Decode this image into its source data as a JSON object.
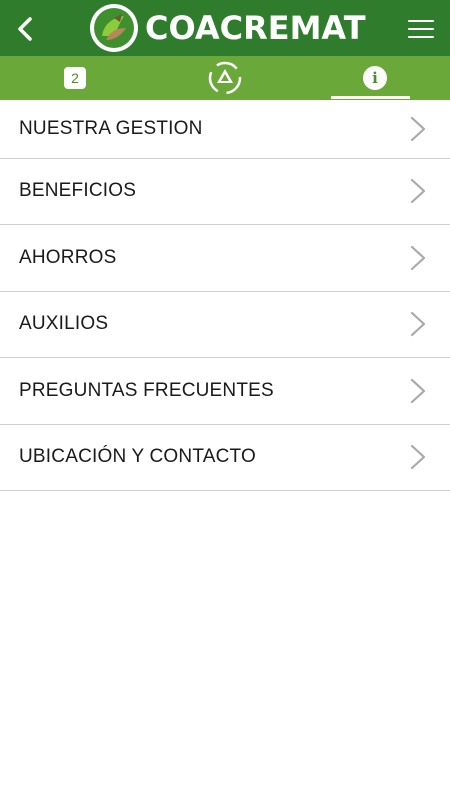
{
  "header": {
    "brand": "COACREMAT",
    "back_icon": "chevron-left-icon",
    "menu_icon": "hamburger-menu-icon",
    "logo_icon": "coacremat-logo",
    "color": "#2f7d2c"
  },
  "tabs": [
    {
      "badge": "2",
      "icon": "notification-badge-icon",
      "active": false
    },
    {
      "icon": "recycle-triangle-icon",
      "active": false
    },
    {
      "icon": "info-icon",
      "symbol": "i",
      "active": true
    }
  ],
  "tab_bar_color": "#6aa83a",
  "menu": {
    "items": [
      {
        "label": "NUESTRA GESTION"
      },
      {
        "label": "BENEFICIOS"
      },
      {
        "label": "AHORROS"
      },
      {
        "label": "AUXILIOS"
      },
      {
        "label": "PREGUNTAS FRECUENTES"
      },
      {
        "label": "UBICACIÓN Y CONTACTO"
      }
    ],
    "chevron_icon": "chevron-right-icon"
  }
}
